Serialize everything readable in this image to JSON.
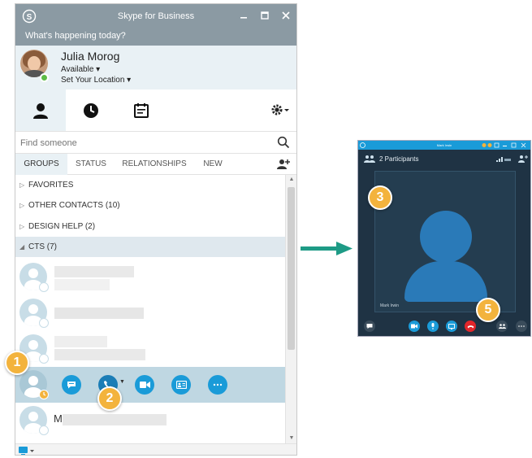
{
  "main_window": {
    "title": "Skype for Business",
    "whats_happening": "What's happening today?",
    "user": {
      "name": "Julia Morog",
      "status": "Available ▾",
      "location": "Set Your Location ▾"
    },
    "nav_tabs": [
      "contacts-icon",
      "recent-icon",
      "meetings-icon"
    ],
    "search": {
      "placeholder": "Find someone"
    },
    "contact_tabs": [
      "GROUPS",
      "STATUS",
      "RELATIONSHIPS",
      "NEW"
    ],
    "groups": [
      {
        "label": "FAVORITES",
        "collapsed": true
      },
      {
        "label": "OTHER CONTACTS (10)",
        "collapsed": true
      },
      {
        "label": "DESIGN HELP (2)",
        "collapsed": true
      },
      {
        "label": "CTS (7)",
        "collapsed": false
      }
    ],
    "selected_contact_initial": "M",
    "quick_actions": [
      "im-icon",
      "phone-icon",
      "video-icon",
      "contact-card-icon",
      "more-icon"
    ]
  },
  "callouts": {
    "one": "1",
    "two": "2",
    "three": "3",
    "five": "5"
  },
  "call_window": {
    "title": "Mark Irwin",
    "participants": "2 Participants",
    "video_name": "Mark Irwin"
  },
  "colors": {
    "titlebar": "#8b9aa3",
    "accent": "#1a9bd8",
    "callout": "#f3b33d",
    "arrow": "#1e9b86",
    "hangup": "#e2262b",
    "available": "#5dbb46"
  }
}
